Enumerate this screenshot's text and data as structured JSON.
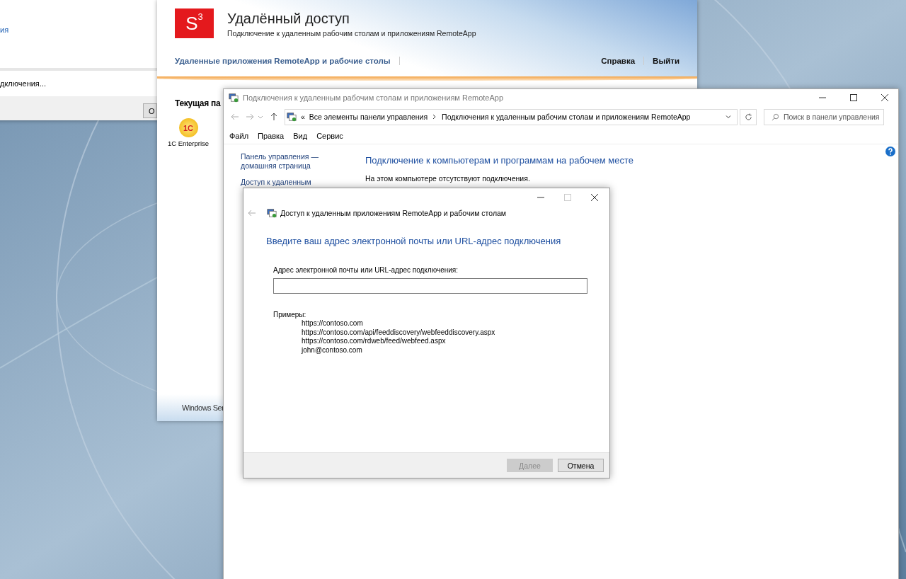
{
  "left_window": {
    "link_fragment": "ия",
    "status_fragment": "дключения...",
    "button_fragment": "О"
  },
  "web_portal": {
    "logo": {
      "letter": "S",
      "superscript": "3"
    },
    "title": "Удалённый доступ",
    "subtitle": "Подключение к удаленным рабочим столам и приложениям RemoteApp",
    "nav_link": "Удаленные приложения RemoteApp и рабочие столы",
    "right_links": [
      "Справка",
      "Выйти"
    ],
    "section_title": "Текущая па",
    "apps": [
      {
        "icon_text": "1С",
        "name": "1C Enterprise"
      }
    ],
    "footer": "Windows Ser"
  },
  "control_panel": {
    "title": "Подключения к удаленным рабочим столам и приложениям RemoteApp",
    "address": {
      "overflow": "«",
      "segments": [
        "Все элементы панели управления",
        "Подключения к удаленным рабочим столам и приложениям RemoteApp"
      ]
    },
    "search": {
      "placeholder": "Поиск в панели управления"
    },
    "menu": [
      "Файл",
      "Правка",
      "Вид",
      "Сервис"
    ],
    "sidebar": [
      {
        "lines": [
          "Панель управления —",
          "домашняя страница"
        ]
      },
      {
        "lines": [
          "Доступ к удаленным"
        ]
      }
    ],
    "heading": "Подключение к компьютерам и программам на рабочем месте",
    "message": "На этом компьютере отсутствуют подключения."
  },
  "dialog": {
    "title": "Доступ к удаленным приложениям RemoteApp и рабочим столам",
    "heading": "Введите ваш адрес электронной почты или URL-адрес подключения",
    "field_label": "Адрес электронной почты или URL-адрес подключения:",
    "examples_label": "Примеры:",
    "examples": [
      "https://contoso.com",
      "https://contoso.com/api/feeddiscovery/webfeeddiscovery.aspx",
      "https://contoso.com/rdweb/feed/webfeed.aspx",
      "john@contoso.com"
    ],
    "buttons": [
      {
        "label": "Далее",
        "disabled": true
      },
      {
        "label": "Отмена",
        "disabled": false
      }
    ]
  }
}
